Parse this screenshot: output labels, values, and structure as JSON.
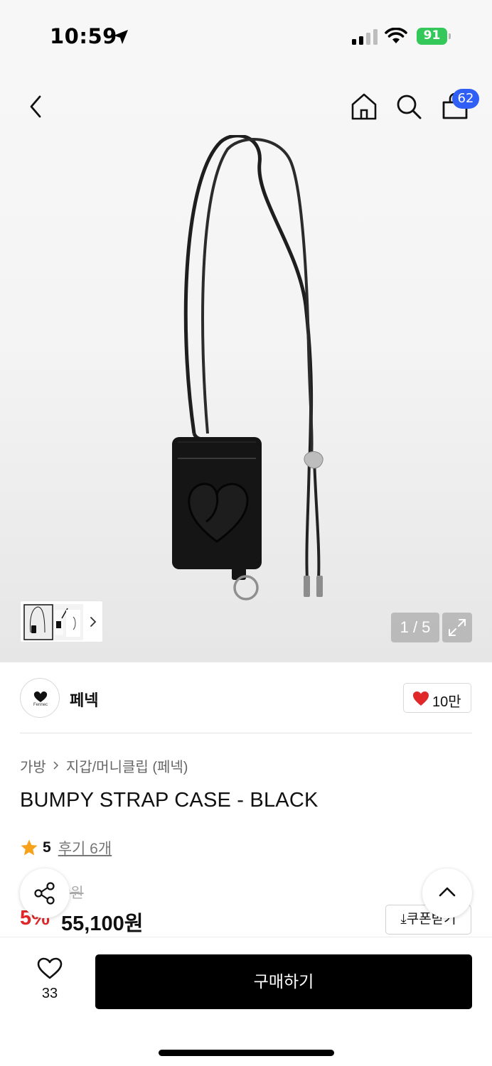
{
  "status_bar": {
    "time": "10:59",
    "battery": "91",
    "battery_color": "#34c759"
  },
  "header": {
    "icons": [
      "back-chevron-icon",
      "home-icon",
      "search-icon",
      "shopping-bag-icon"
    ],
    "cart_count": "62",
    "badge_color": "#2f5ff5"
  },
  "gallery": {
    "page_indicator": "1 / 5",
    "thumbnail_icon": "chevron-right-icon",
    "expand_icon": "expand-icon"
  },
  "brand": {
    "name": "페넥",
    "logo_text": "Fennec",
    "likes": "10만",
    "heart_color": "#e0282b"
  },
  "product": {
    "breadcrumb": [
      "가방",
      "지갑/머니클립 (페넥)"
    ],
    "title": "BUMPY STRAP CASE - BLACK",
    "rating": "5",
    "review_link": "후기 6개",
    "original_price": "0원",
    "discount_rate": "5%",
    "sale_price": "55,100원",
    "coupon_button": "쿠폰받기",
    "discount_color": "#e0282b"
  },
  "bottom_bar": {
    "wish_count": "33",
    "buy_button": "구매하기"
  }
}
